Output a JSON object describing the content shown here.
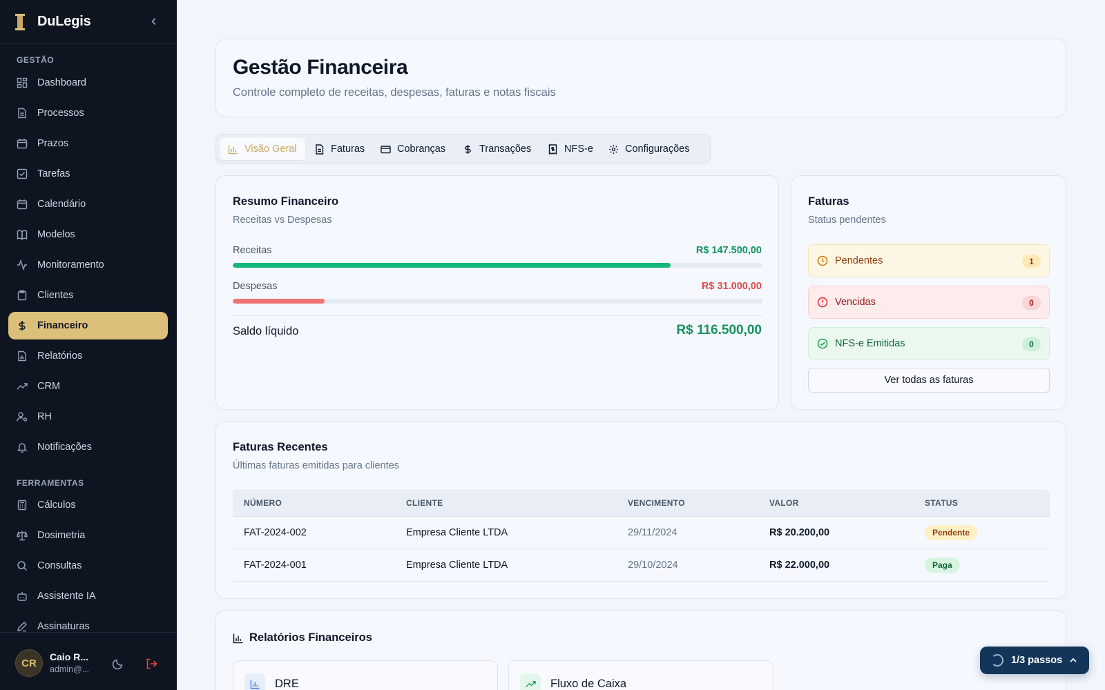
{
  "brand": {
    "name": "DuLegis"
  },
  "sidebar": {
    "sections": [
      {
        "title": "GESTÃO"
      },
      {
        "title": "FERRAMENTAS"
      }
    ],
    "gestao_items": [
      {
        "label": "Dashboard",
        "icon": "dashboard-icon"
      },
      {
        "label": "Processos",
        "icon": "file-icon"
      },
      {
        "label": "Prazos",
        "icon": "calendar-icon"
      },
      {
        "label": "Tarefas",
        "icon": "checkbox-icon"
      },
      {
        "label": "Calendário",
        "icon": "calendar-icon"
      },
      {
        "label": "Modelos",
        "icon": "book-icon"
      },
      {
        "label": "Monitoramento",
        "icon": "activity-icon"
      },
      {
        "label": "Clientes",
        "icon": "clipboard-icon"
      },
      {
        "label": "Financeiro",
        "icon": "dollar-icon",
        "active": true
      },
      {
        "label": "Relatórios",
        "icon": "report-icon"
      },
      {
        "label": "CRM",
        "icon": "trending-up-icon"
      },
      {
        "label": "RH",
        "icon": "user-cog-icon"
      },
      {
        "label": "Notificações",
        "icon": "bell-icon"
      }
    ],
    "ferramentas_items": [
      {
        "label": "Cálculos",
        "icon": "calculator-icon"
      },
      {
        "label": "Dosimetria",
        "icon": "scale-icon"
      },
      {
        "label": "Consultas",
        "icon": "search-icon"
      },
      {
        "label": "Assistente IA",
        "icon": "bot-icon"
      },
      {
        "label": "Assinaturas",
        "icon": "pen-icon"
      }
    ],
    "user": {
      "initials": "CR",
      "name": "Caio R...",
      "email": "admin@..."
    }
  },
  "header": {
    "title": "Gestão Financeira",
    "subtitle": "Controle completo de receitas, despesas, faturas e notas fiscais"
  },
  "tabs": [
    {
      "label": "Visão Geral",
      "active": true
    },
    {
      "label": "Faturas"
    },
    {
      "label": "Cobranças"
    },
    {
      "label": "Transações"
    },
    {
      "label": "NFS-e"
    },
    {
      "label": "Configurações"
    }
  ],
  "resumo": {
    "title": "Resumo Financeiro",
    "subtitle": "Receitas vs Despesas",
    "receitas": {
      "label": "Receitas",
      "value": "R$ 147.500,00",
      "progress": 0.826
    },
    "despesas": {
      "label": "Despesas",
      "value": "R$ 31.000,00",
      "progress": 0.174
    },
    "saldo": {
      "label": "Saldo líquido",
      "value": "R$ 116.500,00"
    }
  },
  "faturas": {
    "title": "Faturas",
    "subtitle": "Status pendentes",
    "status": [
      {
        "label": "Pendentes",
        "count": "1"
      },
      {
        "label": "Vencidas",
        "count": "0"
      },
      {
        "label": "NFS-e Emitidas",
        "count": "0"
      }
    ],
    "button": "Ver todas as faturas"
  },
  "recentes": {
    "title": "Faturas Recentes",
    "subtitle": "Últimas faturas emitidas para clientes",
    "columns": [
      "NÚMERO",
      "CLIENTE",
      "VENCIMENTO",
      "VALOR",
      "STATUS"
    ],
    "rows": [
      {
        "numero": "FAT-2024-002",
        "cliente": "Empresa Cliente LTDA",
        "vencimento": "29/11/2024",
        "valor": "R$ 20.200,00",
        "status": "Pendente"
      },
      {
        "numero": "FAT-2024-001",
        "cliente": "Empresa Cliente LTDA",
        "vencimento": "29/10/2024",
        "valor": "R$ 22.000,00",
        "status": "Paga"
      }
    ]
  },
  "relatorios": {
    "title": "Relatórios Financeiros",
    "cards": [
      {
        "label": "DRE",
        "icon": "bar-chart-icon"
      },
      {
        "label": "Fluxo de Caixa",
        "icon": "trending-up-icon"
      }
    ]
  },
  "wizard": {
    "label": "1/3 passos"
  },
  "colors": {
    "accent": "#dcbf78",
    "sidebar_bg": "#0f1520",
    "income": "#16b77a",
    "expense": "#f07373",
    "saldo": "#16925e",
    "wizard_bg": "#14355a"
  }
}
